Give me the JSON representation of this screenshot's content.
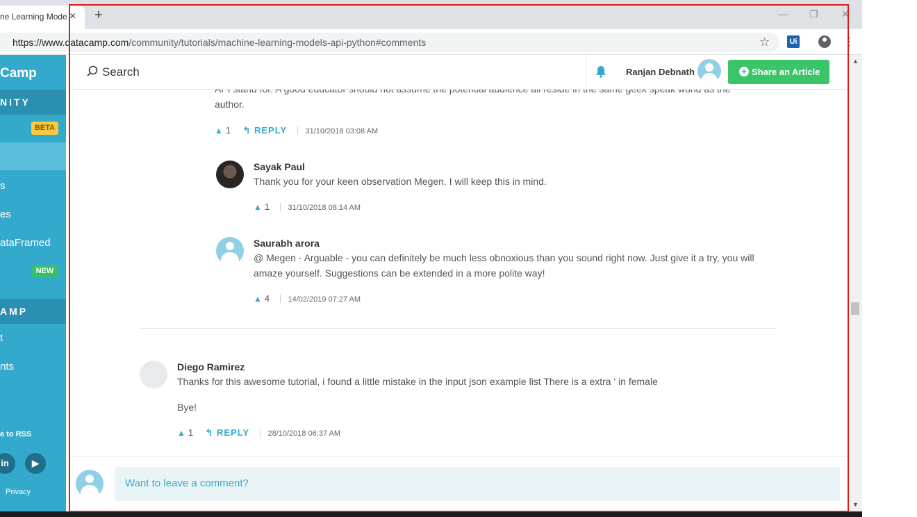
{
  "browser": {
    "tab_title": "ne Learning Mode",
    "tab_close": "×",
    "new_tab": "+",
    "url_host": "https://www.datacamp.com",
    "url_path": "/community/tutorials/machine-learning-models-api-python#comments",
    "minimize": "—",
    "restore": "❐",
    "close": "✕",
    "ext_label": "Ui"
  },
  "sidebar": {
    "brand": "Camp",
    "section1": "NITY",
    "beta": "BETA",
    "item_s": "s",
    "item_es": "es",
    "item_dataframed": "ataFramed",
    "new": "NEW",
    "section2": "AMP",
    "item_t": "t",
    "item_nts": "nts",
    "rss": "e to RSS",
    "linkedin": "in",
    "youtube": "▶",
    "privacy": "Privacy"
  },
  "header": {
    "search_label": "Search",
    "username": "Ranjan Debnath",
    "share_button": "Share an Article",
    "share_plus": "+"
  },
  "comments": {
    "top_partial_line1": "API stand for. A good educator should not assume the potential audience all reside in the same geek speak world as the",
    "top_partial_line2": "author.",
    "top_votes": "1",
    "top_reply": "REPLY",
    "top_date": "31/10/2018 03:08 AM",
    "reply1_author": "Sayak Paul",
    "reply1_text": "Thank you for your keen observation Megen. I will keep this in mind.",
    "reply1_votes": "1",
    "reply1_date": "31/10/2018 08:14 AM",
    "reply2_author": "Saurabh arora",
    "reply2_text_line1": "@ Megen - Arguable - you can definitely be much less obnoxious than you sound right now. Just give it a try, you will",
    "reply2_text_line2": "amaze yourself. Suggestions can be extended in a more polite way!",
    "reply2_votes": "4",
    "reply2_date": "14/02/2019 07:27 AM",
    "c2_author": "Diego Ramirez",
    "c2_text": "Thanks for this awesome tutorial, i found a little mistake in the input json example list There is a extra ' in female",
    "c2_text2": "Bye!",
    "c2_votes": "1",
    "c2_reply": "REPLY",
    "c2_date": "28/10/2018 06:37 AM"
  },
  "footer": {
    "comment_placeholder": "Want to leave a comment?"
  },
  "colors": {
    "accent": "#33aacc",
    "share_green": "#3ac569",
    "frame_red": "#d81b1b"
  }
}
